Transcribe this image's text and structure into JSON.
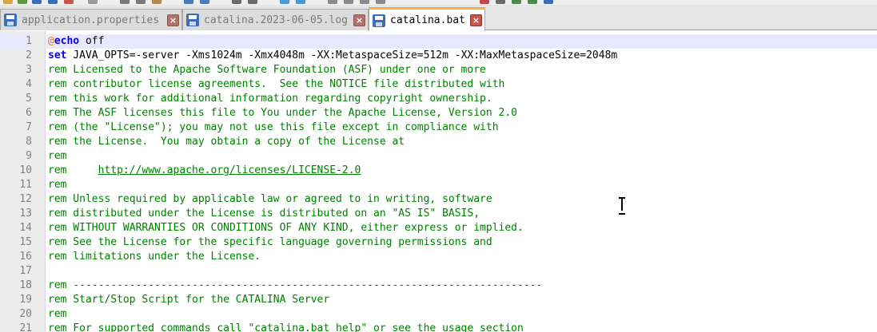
{
  "tabs": [
    {
      "label": "application.properties",
      "active": false,
      "icon": "save-icon",
      "close_glyph": "×"
    },
    {
      "label": "catalina.2023-06-05.log",
      "active": false,
      "icon": "save-icon",
      "close_glyph": "×"
    },
    {
      "label": "catalina.bat",
      "active": true,
      "icon": "save-icon",
      "close_glyph": "×"
    }
  ],
  "editor": {
    "current_line": 1,
    "lines": [
      {
        "n": "1",
        "text": "@echo off"
      },
      {
        "n": "2",
        "text": "set JAVA_OPTS=-server -Xms1024m -Xmx4048m -XX:MetaspaceSize=512m -XX:MaxMetaspaceSize=2048m"
      },
      {
        "n": "3",
        "text": "rem Licensed to the Apache Software Foundation (ASF) under one or more"
      },
      {
        "n": "4",
        "text": "rem contributor license agreements.  See the NOTICE file distributed with"
      },
      {
        "n": "5",
        "text": "rem this work for additional information regarding copyright ownership."
      },
      {
        "n": "6",
        "text": "rem The ASF licenses this file to You under the Apache License, Version 2.0"
      },
      {
        "n": "7",
        "text": "rem (the \"License\"); you may not use this file except in compliance with"
      },
      {
        "n": "8",
        "text": "rem the License.  You may obtain a copy of the License at"
      },
      {
        "n": "9",
        "text": "rem"
      },
      {
        "n": "10",
        "text": "rem     http://www.apache.org/licenses/LICENSE-2.0"
      },
      {
        "n": "11",
        "text": "rem"
      },
      {
        "n": "12",
        "text": "rem Unless required by applicable law or agreed to in writing, software"
      },
      {
        "n": "13",
        "text": "rem distributed under the License is distributed on an \"AS IS\" BASIS,"
      },
      {
        "n": "14",
        "text": "rem WITHOUT WARRANTIES OR CONDITIONS OF ANY KIND, either express or implied."
      },
      {
        "n": "15",
        "text": "rem See the License for the specific language governing permissions and"
      },
      {
        "n": "16",
        "text": "rem limitations under the License."
      },
      {
        "n": "17",
        "text": ""
      },
      {
        "n": "18",
        "text": "rem ---------------------------------------------------------------------------"
      },
      {
        "n": "19",
        "text": "rem Start/Stop Script for the CATALINA Server"
      },
      {
        "n": "20",
        "text": "rem"
      },
      {
        "n": "21",
        "text": "rem For supported commands call \"catalina.bat help\" or see the usage section"
      }
    ]
  },
  "colors": {
    "comment": "#008000",
    "keyword": "#0000ff",
    "at_sign": "#ff8000",
    "current_line_bg": "#e8e8ff",
    "active_tab_accent": "#f5b041"
  }
}
